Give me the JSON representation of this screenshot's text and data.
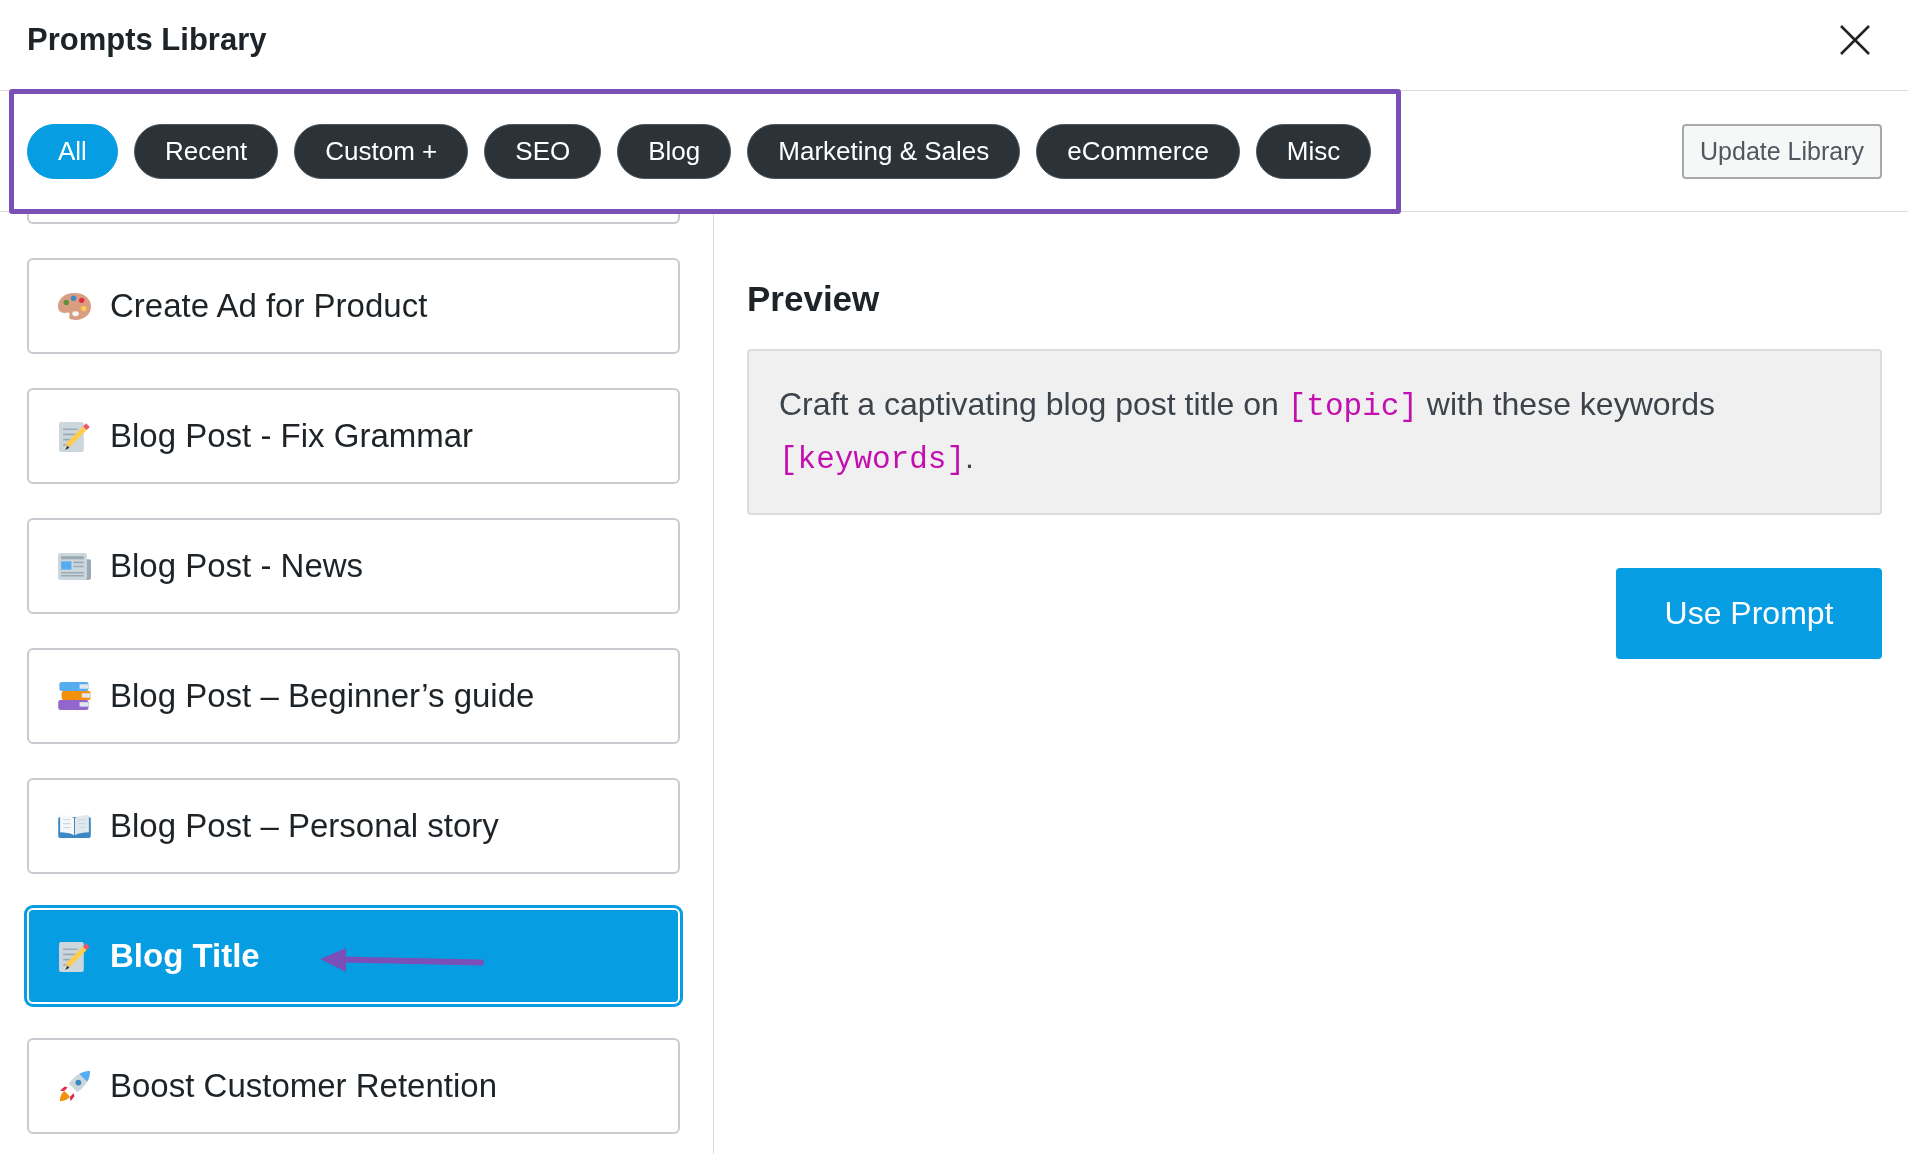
{
  "dialog": {
    "title": "Prompts Library"
  },
  "tabs": [
    {
      "label": "All",
      "selected": true
    },
    {
      "label": "Recent",
      "selected": false
    },
    {
      "label": "Custom +",
      "selected": false
    },
    {
      "label": "SEO",
      "selected": false
    },
    {
      "label": "Blog",
      "selected": false
    },
    {
      "label": "Marketing & Sales",
      "selected": false
    },
    {
      "label": "eCommerce",
      "selected": false
    },
    {
      "label": "Misc",
      "selected": false
    }
  ],
  "update_button": "Update Library",
  "prompts": [
    {
      "label": "Create Ad for Product",
      "selected": false
    },
    {
      "label": "Blog Post - Fix Grammar",
      "selected": false
    },
    {
      "label": "Blog Post - News",
      "selected": false
    },
    {
      "label": "Blog Post – Beginner’s guide",
      "selected": false
    },
    {
      "label": "Blog Post – Personal story",
      "selected": false
    },
    {
      "label": "Blog Title",
      "selected": true
    },
    {
      "label": "Boost Customer Retention",
      "selected": false
    }
  ],
  "preview": {
    "heading": "Preview",
    "text": [
      {
        "kind": "text",
        "text": "Craft a captivating blog post title on "
      },
      {
        "kind": "code",
        "text": "[topic]"
      },
      {
        "kind": "text",
        "text": " with these keywords "
      },
      {
        "kind": "code",
        "text": "[keywords]"
      },
      {
        "kind": "text",
        "text": "."
      }
    ]
  },
  "use_button": "Use Prompt",
  "annotations": {
    "frame_around_tabs": true,
    "arrow_at_selected": true
  }
}
